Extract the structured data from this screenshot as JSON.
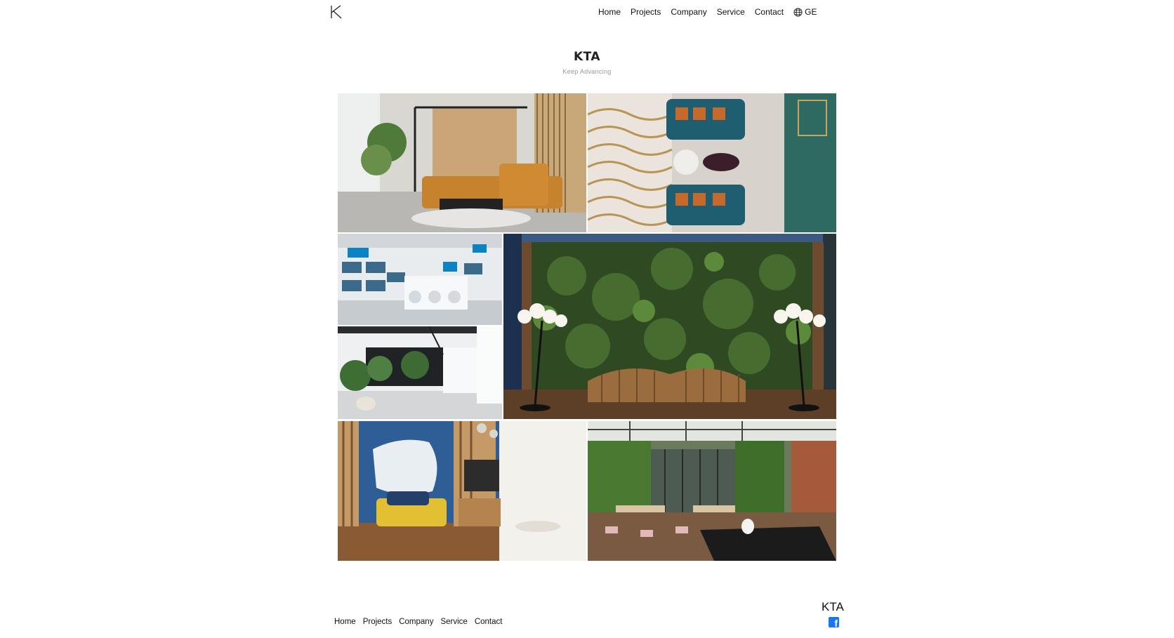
{
  "nav": {
    "items": [
      "Home",
      "Projects",
      "Company",
      "Service",
      "Contact"
    ],
    "language": "GE"
  },
  "hero": {
    "title": "KTA",
    "tagline": "Keep Advancing"
  },
  "gallery": {
    "images": [
      "living-room-orange-sofa",
      "lounge-teal-sofas-aerial",
      "midea-showroom-washers",
      "green-wall-wooden-bench",
      "midea-showroom-entrance",
      "bedroom-blue-wall-yellow-bed",
      "restaurant-greenhouse"
    ]
  },
  "footer": {
    "items": [
      "Home",
      "Projects",
      "Company",
      "Service",
      "Contact"
    ],
    "brand": "KTA",
    "social_icon": "facebook-icon"
  },
  "colors": {
    "facebook": "#1877f2",
    "text": "#111111",
    "tagline": "#999999"
  }
}
